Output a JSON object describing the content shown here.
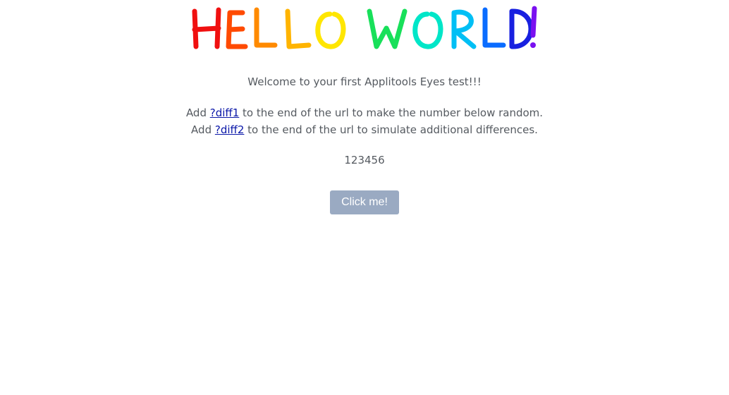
{
  "logo": {
    "text": "HELLO WORLD!",
    "colors": [
      "#f01010",
      "#ff5a00",
      "#ffa200",
      "#ffe600",
      "#14e860",
      "#00e0ff",
      "#0a7cff",
      "#1010e0",
      "#7a10f0"
    ]
  },
  "content": {
    "welcome": "Welcome to your first Applitools Eyes test!!!",
    "diff1_prefix": "Add ",
    "diff1_link": "?diff1",
    "diff1_suffix": " to the end of the url to make the number below random.",
    "diff2_prefix": "Add ",
    "diff2_link": "?diff2",
    "diff2_suffix": " to the end of the url to simulate additional differences.",
    "number": "123456"
  },
  "button": {
    "label": "Click me!"
  },
  "colors": {
    "text": "#555a60",
    "link": "#0a17a8",
    "button_bg": "#9aaac2",
    "button_text": "#ffffff"
  }
}
